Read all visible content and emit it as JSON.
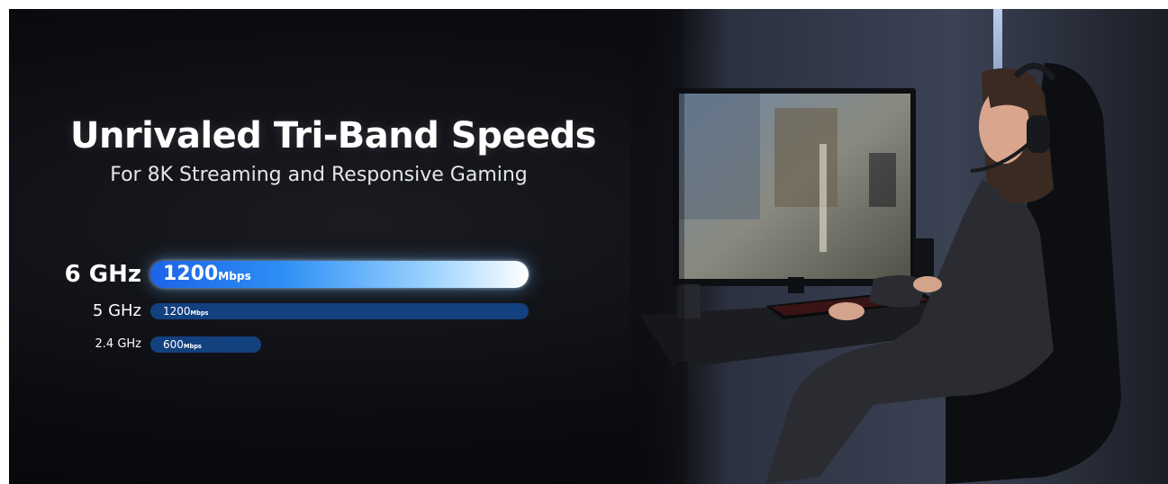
{
  "headline": "Unrivaled Tri-Band Speeds",
  "subheadline": "For 8K Streaming and Responsive Gaming",
  "bands": [
    {
      "label": "6 GHz",
      "speed": "1200",
      "unit": "Mbps"
    },
    {
      "label": "5 GHz",
      "speed": "1200",
      "unit": "Mbps"
    },
    {
      "label": "2.4 GHz",
      "speed": "600",
      "unit": "Mbps"
    }
  ],
  "colors": {
    "background": "#0b0c10",
    "bar_primary_start": "#1d63e8",
    "bar_primary_end": "#ffffff",
    "bar_secondary": "#13407e",
    "text": "#ffffff"
  }
}
